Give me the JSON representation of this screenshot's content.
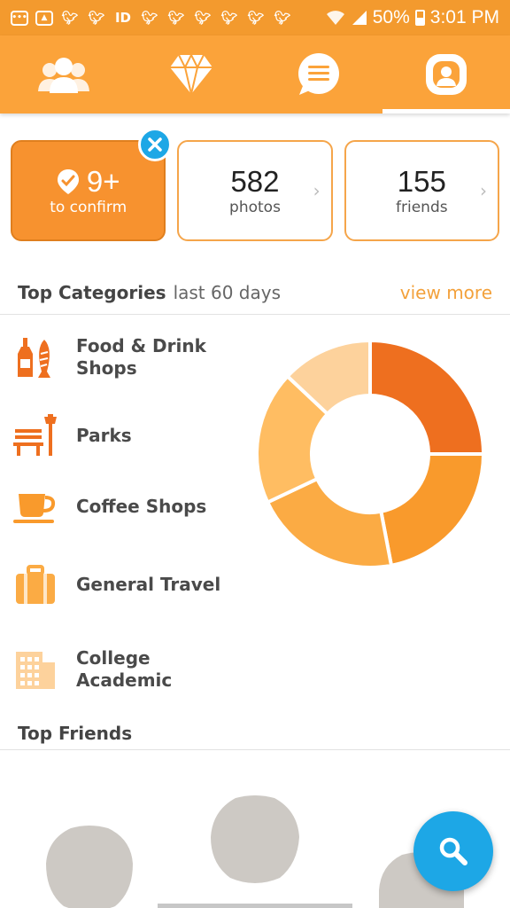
{
  "status_bar": {
    "battery": "50%",
    "time": "3:01 PM",
    "notification_icons": [
      "chat-icon",
      "image-icon",
      "twitter-icon",
      "twitter-icon",
      "deezer-icon",
      "twitter-icon",
      "twitter-icon",
      "twitter-icon",
      "twitter-icon",
      "twitter-icon",
      "twitter-icon"
    ]
  },
  "nav_tabs": [
    {
      "icon": "friends-icon",
      "active": false
    },
    {
      "icon": "diamond-icon",
      "active": false
    },
    {
      "icon": "messages-icon",
      "active": false
    },
    {
      "icon": "profile-icon",
      "active": true
    }
  ],
  "stats": {
    "confirm": {
      "count": "9+",
      "label": "to confirm"
    },
    "photos": {
      "count": "582",
      "label": "photos"
    },
    "friends": {
      "count": "155",
      "label": "friends"
    }
  },
  "top_categories": {
    "title": "Top Categories",
    "subtitle": "last 60 days",
    "view_more": "view more",
    "items": [
      {
        "label": "Food & Drink Shops",
        "icon": "food-drink-icon"
      },
      {
        "label": "Parks",
        "icon": "park-bench-icon"
      },
      {
        "label": "Coffee Shops",
        "icon": "coffee-cup-icon"
      },
      {
        "label": "General Travel",
        "icon": "suitcase-icon"
      },
      {
        "label": "College Academic",
        "icon": "building-icon"
      }
    ]
  },
  "chart_data": {
    "type": "pie",
    "labels": [
      "Food & Drink Shops",
      "Parks",
      "Coffee Shops",
      "General Travel",
      "College Academic"
    ],
    "values": [
      25,
      22,
      21,
      19,
      13
    ],
    "colors": [
      "#ee6f1f",
      "#f99a2c",
      "#fbab44",
      "#ffbd62",
      "#fdd29c"
    ]
  },
  "top_friends": {
    "title": "Top Friends"
  },
  "colors": {
    "status_bar": "#f39a2e",
    "nav": "#fba33a",
    "accent": "#f3a13b",
    "fab": "#1da7e6"
  }
}
